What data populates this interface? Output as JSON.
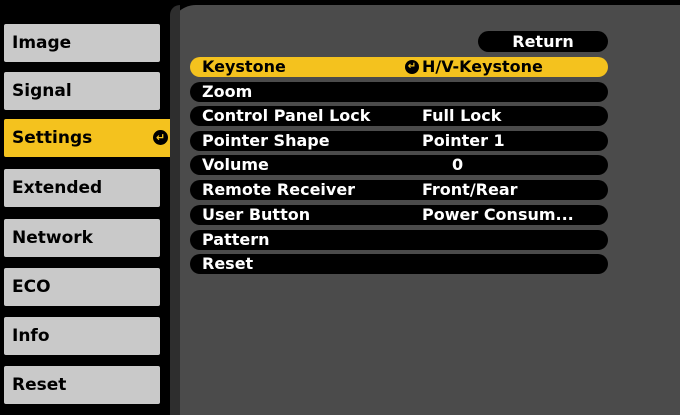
{
  "sidebar": {
    "tabs": [
      {
        "label": "Image"
      },
      {
        "label": "Signal"
      },
      {
        "label": "Settings",
        "active": true
      },
      {
        "label": "Extended"
      },
      {
        "label": "Network"
      },
      {
        "label": "ECO"
      },
      {
        "label": "Info"
      },
      {
        "label": "Reset"
      }
    ]
  },
  "panel": {
    "return_label": "Return",
    "rows": [
      {
        "label": "Keystone",
        "value": "H/V-Keystone",
        "selected": true,
        "value_icon": "enter-arrow-icon"
      },
      {
        "label": "Zoom",
        "value": ""
      },
      {
        "label": "Control Panel Lock",
        "value": "Full Lock"
      },
      {
        "label": "Pointer Shape",
        "value": "Pointer 1"
      },
      {
        "label": "Volume",
        "value": "0"
      },
      {
        "label": "Remote Receiver",
        "value": "Front/Rear"
      },
      {
        "label": "User Button",
        "value": "Power Consum..."
      },
      {
        "label": "Pattern",
        "value": ""
      },
      {
        "label": "Reset",
        "value": ""
      }
    ]
  },
  "colors": {
    "accent": "#f4c21e",
    "tab_background": "#c9c9c9",
    "panel_background": "#4b4b4b",
    "row_background": "#000000"
  }
}
